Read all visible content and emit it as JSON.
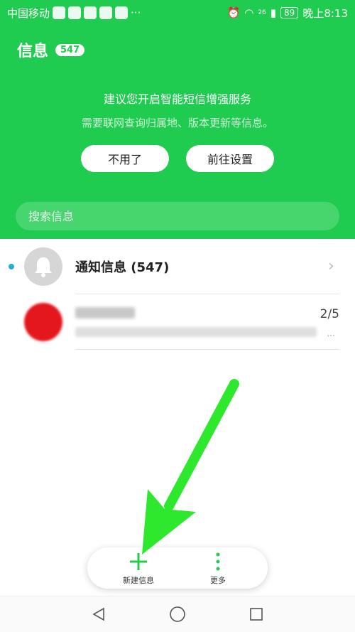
{
  "status_bar": {
    "carrier": "中国移动",
    "battery": "89",
    "time": "晚上8:13",
    "more": "···",
    "signal_label": "26"
  },
  "header": {
    "title": "信息",
    "badge": "547"
  },
  "promo": {
    "title": "建议您开启智能短信增强服务",
    "subtitle": "需要联网查询归属地、版本更新等信息。",
    "decline_label": "不用了",
    "settings_label": "前往设置"
  },
  "search": {
    "placeholder": "搜索信息"
  },
  "conversations": [
    {
      "title": "通知信息 (547)",
      "unread": true
    },
    {
      "count": "2/5",
      "more": "..."
    }
  ],
  "bottom_bar": {
    "new_label": "新建信息",
    "more_label": "更多"
  },
  "colors": {
    "brand_green": "#1fcc4f",
    "unread_blue": "#2aa8e0",
    "arrow_green": "#2ee82e"
  }
}
